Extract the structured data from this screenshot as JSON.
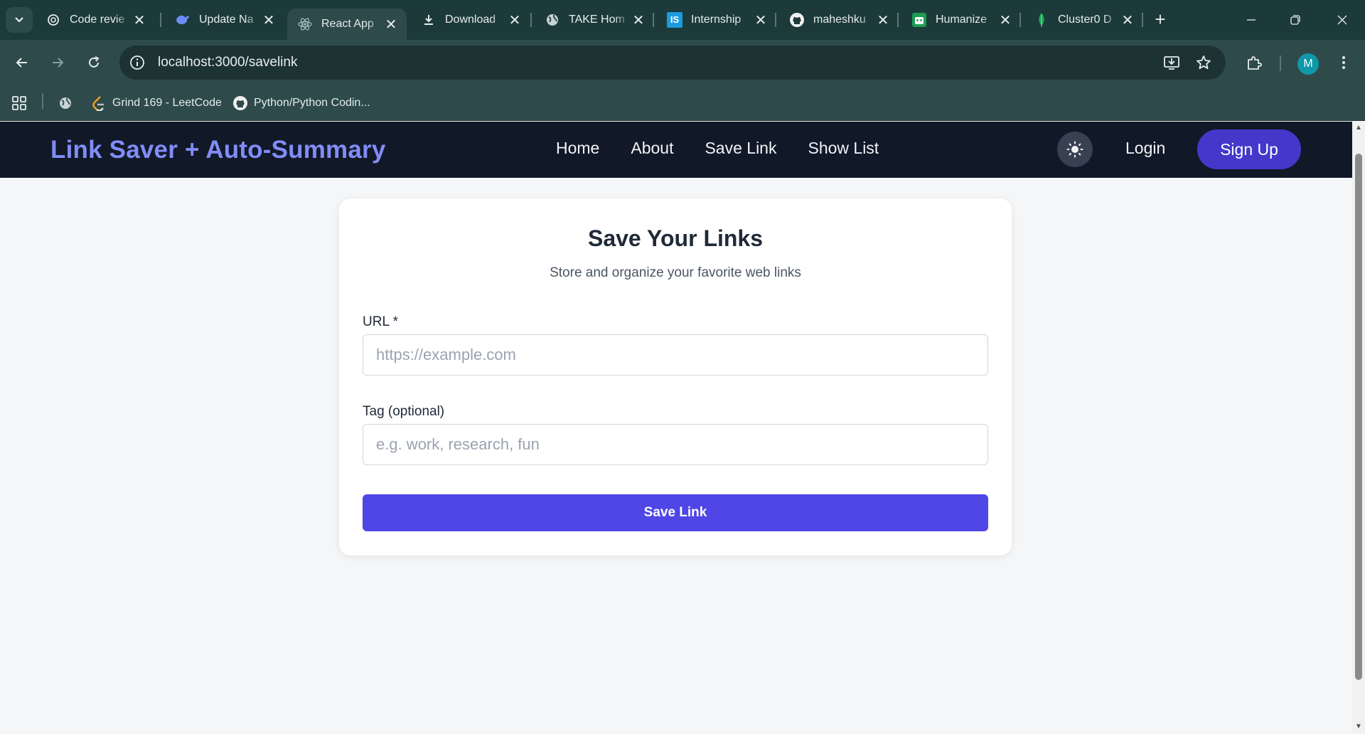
{
  "browser": {
    "tabs": [
      {
        "title": "Code revie",
        "icon": "openai-icon"
      },
      {
        "title": "Update Na",
        "icon": "deepseek-icon"
      },
      {
        "title": "React App",
        "icon": "react-icon",
        "active": true
      },
      {
        "title": "Download",
        "icon": "download-icon"
      },
      {
        "title": "TAKE Hom",
        "icon": "globe-icon"
      },
      {
        "title": "Internship",
        "icon": "is-icon",
        "badge": "IS"
      },
      {
        "title": "maheshku",
        "icon": "github-icon"
      },
      {
        "title": "Humanize",
        "icon": "humanize-icon"
      },
      {
        "title": "Cluster0 D",
        "icon": "mongodb-leaf-icon"
      }
    ],
    "close_glyph": "✕",
    "new_tab_glyph": "+",
    "url": "localhost:3000/savelink",
    "profile_initial": "M",
    "bookmarks": [
      {
        "title": "Grind 169 - LeetCode",
        "icon": "leetcode-icon"
      },
      {
        "title": "Python/Python Codin...",
        "icon": "github-icon"
      }
    ]
  },
  "app": {
    "brand": "Link Saver + Auto-Summary",
    "nav": {
      "home": "Home",
      "about": "About",
      "save_link": "Save Link",
      "show_list": "Show List"
    },
    "login": "Login",
    "signup": "Sign Up",
    "theme_icon": "sun-icon"
  },
  "form": {
    "title": "Save Your Links",
    "subtitle": "Store and organize your favorite web links",
    "url_label": "URL *",
    "url_placeholder": "https://example.com",
    "url_value": "",
    "tag_label": "Tag (optional)",
    "tag_placeholder": "e.g. work, research, fun",
    "tag_value": "",
    "submit": "Save Link"
  },
  "colors": {
    "brand": "#818cf8",
    "nav_bg": "#111827",
    "signup_bg": "#4338ca",
    "submit_bg": "#4f46e5",
    "chrome_bg": "#2e4a4a"
  }
}
